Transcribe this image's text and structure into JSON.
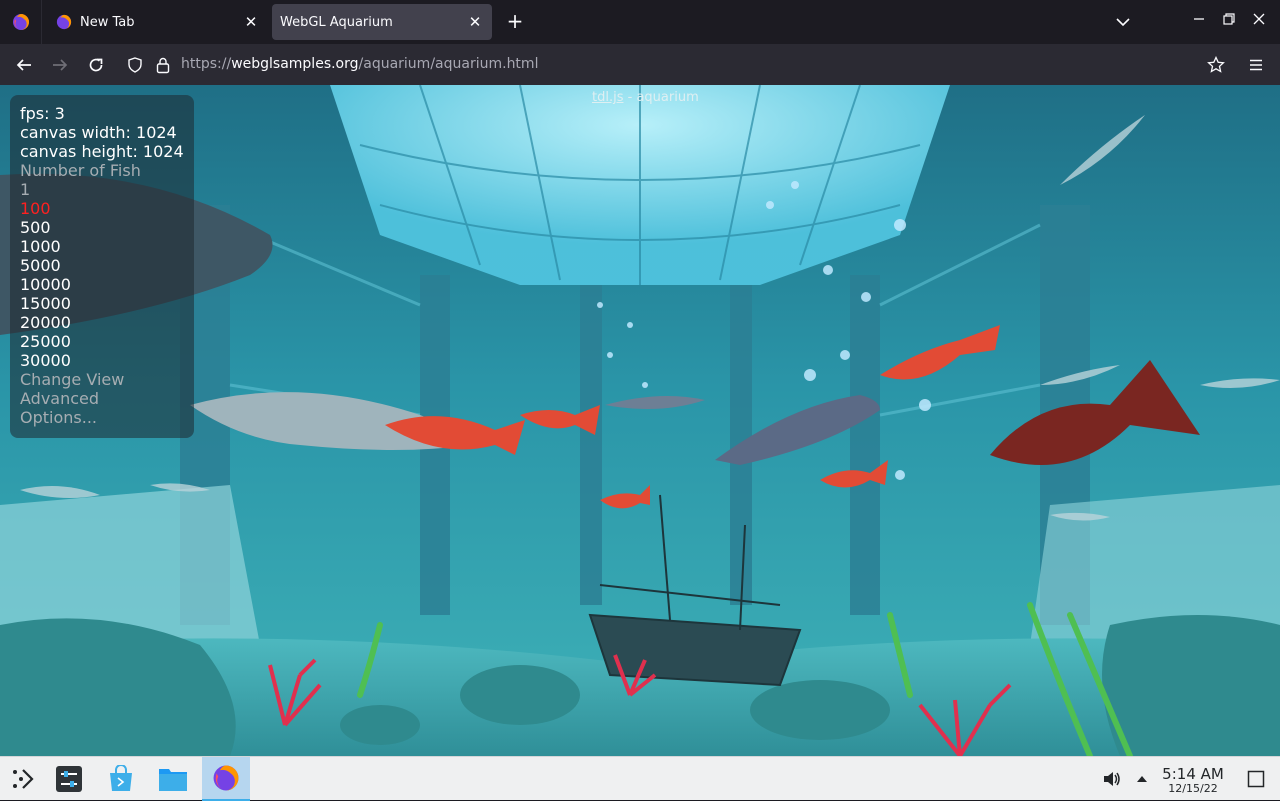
{
  "browser": {
    "tabs": [
      {
        "label": "New Tab",
        "active": false
      },
      {
        "label": "WebGL Aquarium",
        "active": true
      }
    ],
    "url": {
      "scheme": "https://",
      "host": "webglsamples.org",
      "path": "/aquarium/aquarium.html"
    }
  },
  "page": {
    "credit_link": "tdl.js",
    "credit_sep": " - ",
    "credit_text": "aquarium",
    "stats": {
      "fps": "fps: 3",
      "canvas_width": "canvas width: 1024",
      "canvas_height": "canvas height: 1024"
    },
    "fish_menu": {
      "heading": "Number of Fish",
      "options": [
        "1",
        "100",
        "500",
        "1000",
        "5000",
        "10000",
        "15000",
        "20000",
        "25000",
        "30000"
      ],
      "selected": "100"
    },
    "menu_items": [
      "Change View",
      "Advanced",
      "Options..."
    ]
  },
  "taskbar": {
    "time": "5:14 AM",
    "date": "12/15/22"
  },
  "colors": {
    "selected_option": "#ff2020",
    "panel_text_grey": "#a6adb2",
    "tab_bar": "#1c1b22",
    "nav_bar": "#2b2a33",
    "active_tab": "#42414d",
    "taskbar": "#eff0f1",
    "taskbar_active": "#b6d6ef"
  }
}
